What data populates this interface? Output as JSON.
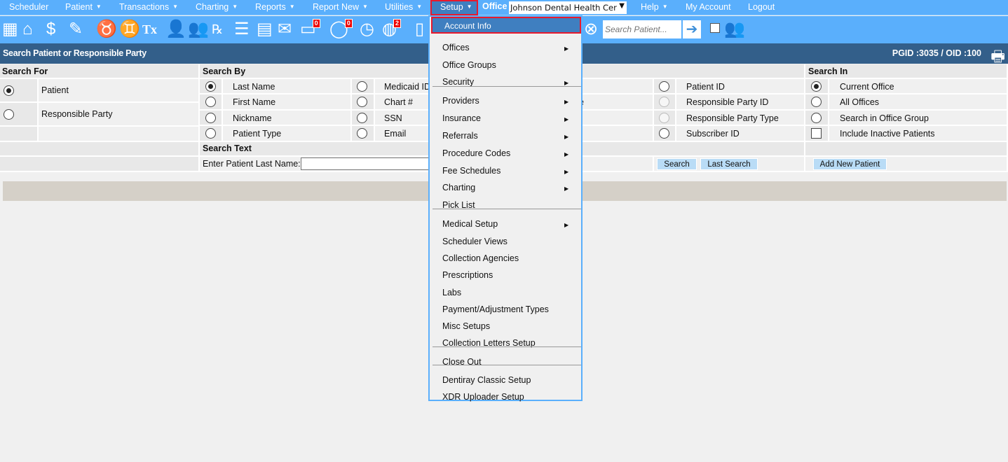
{
  "nav": {
    "items": [
      {
        "label": "Scheduler",
        "caret": false
      },
      {
        "label": "Patient",
        "caret": true
      },
      {
        "label": "Transactions",
        "caret": true
      },
      {
        "label": "Charting",
        "caret": true
      },
      {
        "label": "Reports",
        "caret": true
      },
      {
        "label": "Report New",
        "caret": true
      },
      {
        "label": "Utilities",
        "caret": true
      }
    ],
    "setup": "Setup",
    "office_label": "Office",
    "office_value": "Johnson Dental Health Cer",
    "help": "Help",
    "my_account": "My Account",
    "logout": "Logout"
  },
  "toolbar": {
    "icons": [
      "calendar-icon",
      "home-icon",
      "billing-icon",
      "edit-notes-icon",
      "tooth-icon",
      "tooth-crown-icon",
      "tx-plan-icon",
      "add-patient-icon",
      "add-family-icon",
      "prescription-icon",
      "notepad-icon",
      "print-document-icon",
      "mail-icon",
      "messages-icon",
      "chat-icon",
      "clock-icon",
      "globe-user-icon",
      "tooth-chart-icon"
    ],
    "messages_badge": "0",
    "chat_badge": "0",
    "globe_badge": "2",
    "search_placeholder": "Search Patient..."
  },
  "titlebar": {
    "title": "Search Patient or Responsible Party",
    "pgid": "PGID :3035  /  OID :100"
  },
  "search_for": {
    "header": "Search For",
    "options": [
      "Patient",
      "Responsible Party"
    ],
    "selected": "Patient"
  },
  "search_by": {
    "header": "Search By",
    "col1": [
      "Last Name",
      "First Name",
      "Nickname",
      "Patient Type"
    ],
    "col2": [
      "Medicaid ID",
      "Chart #",
      "SSN",
      "Email"
    ],
    "col3_partial": "e",
    "col4": [
      "Patient ID",
      "Responsible Party ID",
      "Responsible Party Type",
      "Subscriber ID"
    ],
    "selected": "Last Name"
  },
  "search_in": {
    "header": "Search In",
    "options": [
      "Current Office",
      "All Offices",
      "Search in Office Group"
    ],
    "checkbox": "Include Inactive Patients",
    "selected": "Current Office"
  },
  "search_text": {
    "header": "Search Text",
    "label": "Enter Patient Last Name:",
    "value": "",
    "search_btn": "Search",
    "last_search_btn": "Last Search",
    "add_new_btn": "Add New Patient"
  },
  "setup_menu": {
    "items": [
      "Account Info",
      "Offices",
      "Office Groups",
      "Security",
      "Providers",
      "Insurance",
      "Referrals",
      "Procedure Codes",
      "Fee Schedules",
      "Charting",
      "Pick List",
      "Medical Setup",
      "Scheduler Views",
      "Collection Agencies",
      "Prescriptions",
      "Labs",
      "Payment/Adjustment Types",
      "Misc Setups",
      "Collection Letters Setup",
      "Close Out",
      "Dentiray Classic Setup",
      "XDR Uploader Setup"
    ],
    "highlighted": "Account Info"
  },
  "colors": {
    "nav_blue": "#5aaffc",
    "title_blue": "#335f8a",
    "highlight": "#3f7fc0",
    "focus_border": "#e8192c"
  }
}
